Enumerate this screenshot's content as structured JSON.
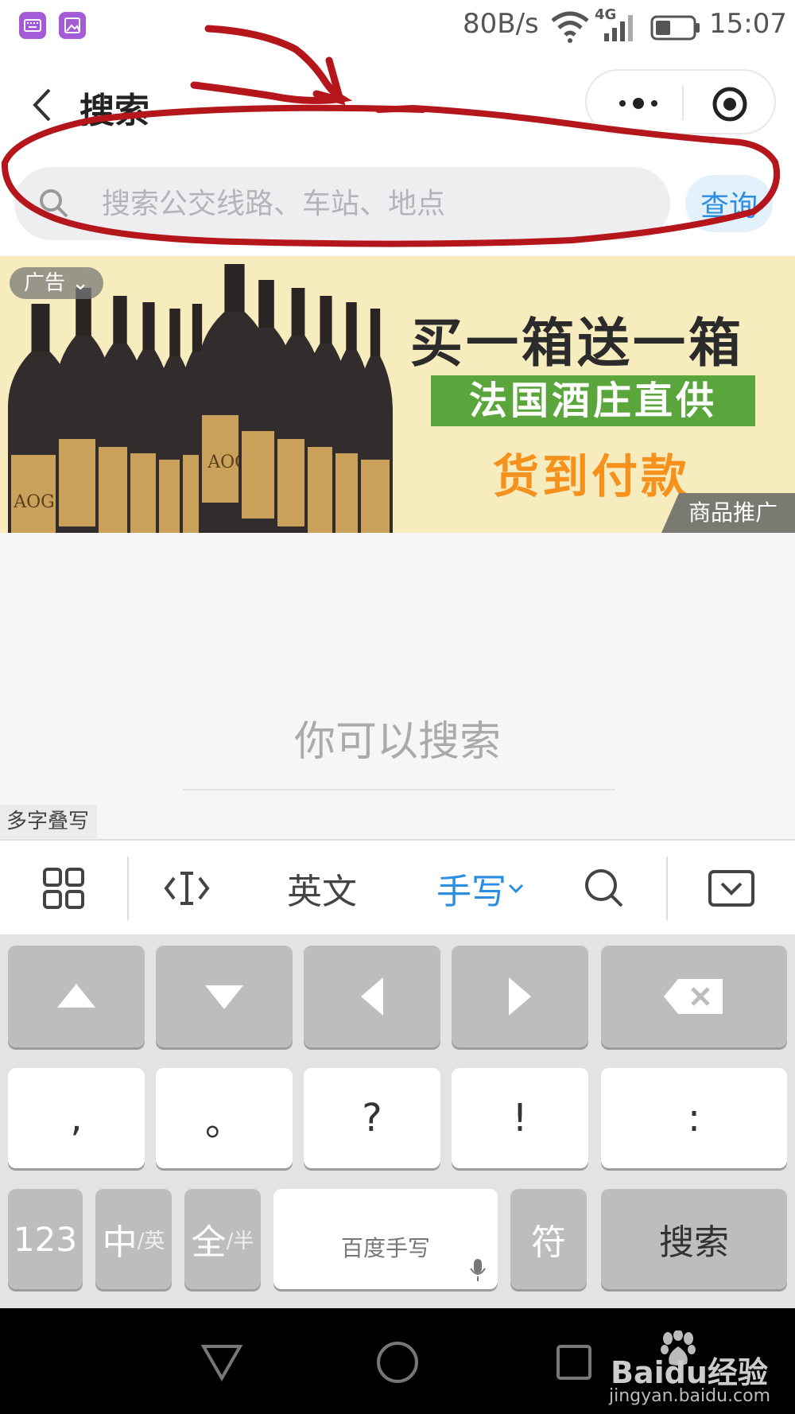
{
  "status_bar": {
    "speed": "80B/s",
    "network": "4G",
    "time": "15:07"
  },
  "header": {
    "title": "搜索"
  },
  "search": {
    "placeholder": "搜索公交线路、车站、地点",
    "query_label": "查询"
  },
  "ad": {
    "tag": "广告",
    "headline": "买一箱送一箱",
    "green_line": "法国酒庄直供",
    "orange_line": "货到付款",
    "promo_label": "商品推广",
    "bottle_label": "AOGE"
  },
  "content": {
    "hint": "你可以搜索"
  },
  "handwriting": {
    "multi_label": "多字叠写"
  },
  "keyboard_toolbar": {
    "english": "英文",
    "handwrite": "手写"
  },
  "keyboard": {
    "row2": [
      ",",
      "。",
      "?",
      "!",
      ":"
    ],
    "num": "123",
    "zh": "中",
    "zh_sub": "/英",
    "full": "全",
    "full_sub": "/半",
    "space": "百度手写",
    "symbol": "符",
    "search": "搜索"
  },
  "watermark": {
    "brand": "Baidu经验",
    "url": "jingyan.baidu.com"
  },
  "colors": {
    "accent": "#2c8ee0",
    "annotation": "#b5161b",
    "ad_bg": "#f7ecbd",
    "ad_green": "#5ba63c",
    "ad_orange": "#f5921e"
  }
}
